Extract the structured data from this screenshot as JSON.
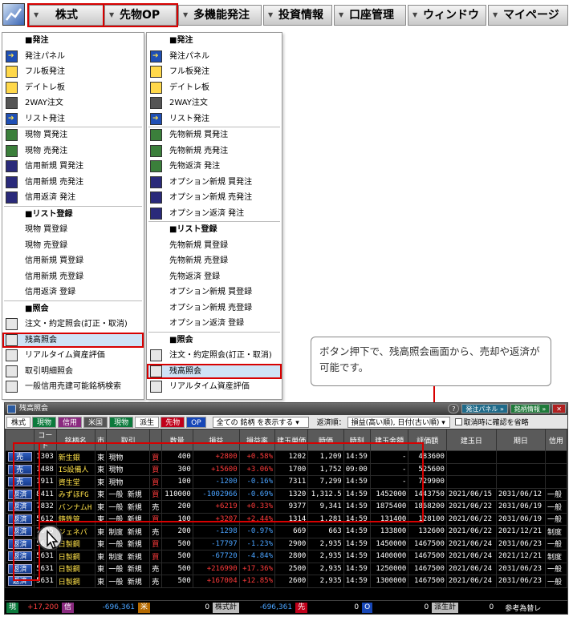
{
  "menubar": {
    "tabs": [
      "株式",
      "先物OP",
      "多機能発注",
      "投資情報",
      "口座管理",
      "ウィンドウ",
      "マイページ"
    ]
  },
  "menu_stock": {
    "order_header": "■発注",
    "order": [
      "発注パネル",
      "フル板発注",
      "デイトレ板",
      "2WAY注文",
      "リスト発注"
    ],
    "trade": [
      "現物 買発注",
      "現物 売発注",
      "信用新規 買発注",
      "信用新規 売発注",
      "信用返済 発注"
    ],
    "list_header": "■リスト登録",
    "list": [
      "現物 買登録",
      "現物 売登録",
      "信用新規 買登録",
      "信用新規 売登録",
      "信用返済 登録"
    ],
    "inq_header": "■照会",
    "inq": [
      "注文・約定照会(訂正・取消)",
      "残高照会",
      "リアルタイム資産評価",
      "取引明細照会",
      "一般信用売建可能銘柄検索"
    ]
  },
  "menu_futures": {
    "order_header": "■発注",
    "order": [
      "発注パネル",
      "フル板発注",
      "デイトレ板",
      "2WAY注文",
      "リスト発注"
    ],
    "trade": [
      "先物新規 買発注",
      "先物新規 売発注",
      "先物返済 発注",
      "オプション新規 買発注",
      "オプション新規 売発注",
      "オプション返済 発注"
    ],
    "list_header": "■リスト登録",
    "list": [
      "先物新規 買登録",
      "先物新規 売登録",
      "先物返済 登録",
      "オプション新規 買登録",
      "オプション新規 売登録",
      "オプション返済 登録"
    ],
    "inq_header": "■照会",
    "inq": [
      "注文・約定照会(訂正・取消)",
      "残高照会",
      "リアルタイム資産評価"
    ]
  },
  "callout": "ボタン押下で、残高照会画面から、売却や返済が可能です。",
  "window": {
    "title": "残高照会",
    "title_buttons": [
      "発注パネル »",
      "銘柄情報 »"
    ],
    "filters": [
      "株式",
      "現物",
      "信用",
      "米国",
      "現物",
      "派生",
      "先物",
      "OP"
    ],
    "display_select": "全ての 銘柄 を表示する",
    "sort_label": "返済順：",
    "sort_select": "損益(高い順), 日付(古い順)",
    "confirm_label": "取消時に確認を省略",
    "columns": [
      "",
      "コード",
      "銘柄名",
      "市",
      "取引",
      "",
      "数量",
      "損益",
      "損益率",
      "建玉単価",
      "時価",
      "時刻",
      "建玉金額",
      "評価額",
      "建玉日",
      "期日",
      "信用"
    ],
    "rows": [
      [
        "売",
        "1303",
        "新生銀",
        "東",
        "現物",
        "買",
        "400",
        "+2800",
        "+0.58%",
        "1202",
        "1,209",
        "14:59",
        "-",
        "483600",
        "",
        "",
        ""
      ],
      [
        "売",
        "1488",
        "IS設備人",
        "東",
        "現物",
        "買",
        "300",
        "+15600",
        "+3.06%",
        "1700",
        "1,752",
        "09:00",
        "-",
        "525600",
        "",
        "",
        ""
      ],
      [
        "売",
        "1911",
        "資生堂",
        "東",
        "現物",
        "買",
        "100",
        "-1200",
        "-0.16%",
        "7311",
        "7,299",
        "14:59",
        "-",
        "729900",
        "",
        "",
        ""
      ],
      [
        "返済",
        "8411",
        "みずほFG",
        "東",
        "一般 新規",
        "買",
        "110000",
        "-1002966",
        "-0.69%",
        "1320",
        "1,312.5",
        "14:59",
        "1452000",
        "1443750",
        "2021/06/15",
        "2031/06/12",
        "一般"
      ],
      [
        "返済",
        "7832",
        "バンナムH",
        "東",
        "一般 新規",
        "売",
        "200",
        "+6219",
        "+0.33%",
        "9377",
        "9,341",
        "14:59",
        "1875400",
        "1868200",
        "2021/06/22",
        "2031/06/19",
        "一般"
      ],
      [
        "返済",
        "5612",
        "鋳鉄管",
        "東",
        "一般 新規",
        "買",
        "100",
        "+3207",
        "+2.44%",
        "1314",
        "1,281",
        "14:59",
        "131400",
        "128100",
        "2021/06/22",
        "2031/06/19",
        "一般"
      ],
      [
        "返済",
        "7005",
        "ジェネパ",
        "東",
        "制度 新規",
        "売",
        "200",
        "-1298",
        "-0.97%",
        "669",
        "663",
        "14:59",
        "133800",
        "132600",
        "2021/06/22",
        "2021/12/21",
        "制度"
      ],
      [
        "返済",
        "5631",
        "日製鋼",
        "東",
        "一般 新規",
        "買",
        "500",
        "-17797",
        "-1.23%",
        "2900",
        "2,935",
        "14:59",
        "1450000",
        "1467500",
        "2021/06/24",
        "2031/06/23",
        "一般"
      ],
      [
        "返済",
        "5631",
        "日製鋼",
        "東",
        "制度 新規",
        "買",
        "500",
        "-67720",
        "-4.84%",
        "2800",
        "2,935",
        "14:59",
        "1400000",
        "1467500",
        "2021/06/24",
        "2021/12/21",
        "制度"
      ],
      [
        "返済",
        "5631",
        "日製鋼",
        "東",
        "一般 新規",
        "売",
        "500",
        "+216990",
        "+17.36%",
        "2500",
        "2,935",
        "14:59",
        "1250000",
        "1467500",
        "2021/06/24",
        "2031/06/23",
        "一般"
      ],
      [
        "返済",
        "5631",
        "日製鋼",
        "東",
        "一般 新規",
        "売",
        "500",
        "+167004",
        "+12.85%",
        "2600",
        "2,935",
        "14:59",
        "1300000",
        "1467500",
        "2021/06/24",
        "2031/06/23",
        "一般"
      ]
    ],
    "status": {
      "genbutsu": "+17,200",
      "shinyou": "-696,361",
      "bei": "0",
      "kabu_total_label": "株式計",
      "kabu_total": "-696,361",
      "sakimono": "0",
      "op": "0",
      "hasei_label": "派生計",
      "hasei": "0",
      "ref": "参考為替レ"
    }
  }
}
